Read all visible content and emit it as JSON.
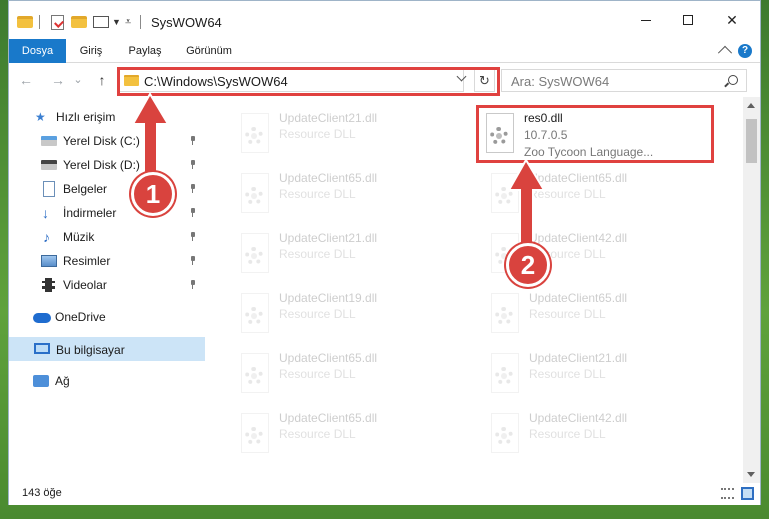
{
  "window": {
    "title": "SysWOW64",
    "controls": {
      "minimize": "—",
      "maximize": "☐",
      "close": "✕"
    }
  },
  "ribbon": {
    "tabs": [
      "Dosya",
      "Giriş",
      "Paylaş",
      "Görünüm"
    ],
    "active_tab": "Dosya",
    "help": "?"
  },
  "nav": {
    "back": "←",
    "forward": "→",
    "recent": "⌄",
    "up": "↑",
    "address": "C:\\Windows\\SysWOW64",
    "refresh": "↻",
    "search_placeholder": "Ara: SysWOW64"
  },
  "sidebar": {
    "items": [
      {
        "label": "Hızlı erişim",
        "icon": "star-icon"
      },
      {
        "label": "Yerel Disk (C:)",
        "icon": "drive-icon",
        "pinned": true
      },
      {
        "label": "Yerel Disk (D:)",
        "icon": "drive-icon",
        "pinned": true
      },
      {
        "label": "Belgeler",
        "icon": "document-icon",
        "pinned": true
      },
      {
        "label": "İndirmeler",
        "icon": "download-icon",
        "pinned": true
      },
      {
        "label": "Müzik",
        "icon": "music-icon",
        "pinned": true
      },
      {
        "label": "Resimler",
        "icon": "pictures-icon",
        "pinned": true
      },
      {
        "label": "Videolar",
        "icon": "video-icon",
        "pinned": true
      },
      {
        "label": "OneDrive",
        "icon": "cloud-icon"
      },
      {
        "label": "Bu bilgisayar",
        "icon": "computer-icon",
        "selected": true
      },
      {
        "label": "Ağ",
        "icon": "network-icon"
      }
    ]
  },
  "files": {
    "left_column": [
      {
        "name": "UpdateClient21.dll",
        "type": "Resource DLL"
      },
      {
        "name": "UpdateClient65.dll",
        "type": "Resource DLL"
      },
      {
        "name": "UpdateClient21.dll",
        "type": "Resource DLL"
      },
      {
        "name": "UpdateClient19.dll",
        "type": "Resource DLL"
      },
      {
        "name": "UpdateClient65.dll",
        "type": "Resource DLL"
      },
      {
        "name": "UpdateClient65.dll",
        "type": "Resource DLL"
      }
    ],
    "right_column": [
      {
        "name": "UpdateClient65.dll",
        "type": "Resource DLL"
      },
      {
        "name": "UpdateClient42.dll",
        "type": "Resource DLL"
      },
      {
        "name": "UpdateClient65.dll",
        "type": "Resource DLL"
      },
      {
        "name": "UpdateClient21.dll",
        "type": "Resource DLL"
      },
      {
        "name": "UpdateClient42.dll",
        "type": "Resource DLL"
      }
    ],
    "highlighted": {
      "name": "res0.dll",
      "version": "10.7.0.5",
      "description": "Zoo Tycoon Language..."
    }
  },
  "status": {
    "item_count": "143 öğe"
  },
  "annotations": {
    "step1": "1",
    "step2": "2",
    "color": "#d9433e"
  }
}
